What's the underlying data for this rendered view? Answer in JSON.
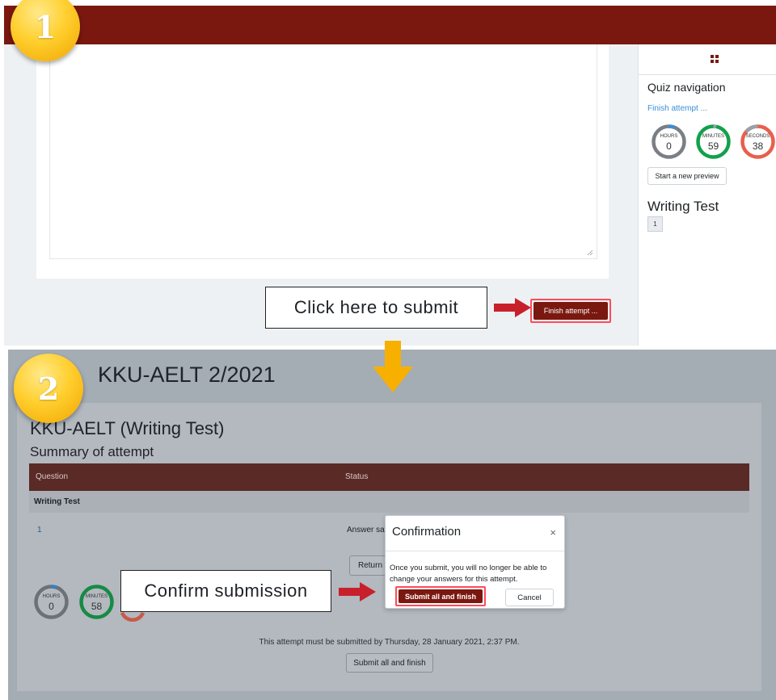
{
  "steps": {
    "step1": "1",
    "step2": "2"
  },
  "panel1": {
    "finish_button_label": "Finish attempt ...",
    "callout": "Click here to submit",
    "sidebar": {
      "quiz_navigation_title": "Quiz navigation",
      "finish_link": "Finish attempt ...",
      "timers": [
        {
          "label": "HOURS",
          "value": "0",
          "color": "#7a7f85"
        },
        {
          "label": "MINUTES",
          "value": "59",
          "color": "#12a14b"
        },
        {
          "label": "SECONDS",
          "value": "38",
          "color": "#e8604c"
        }
      ],
      "preview_button_label": "Start a new preview",
      "section_title": "Writing Test",
      "question_numbers": [
        "1"
      ]
    }
  },
  "panel2": {
    "course_title": "KKU-AELT 2/2021",
    "quiz_title": "KKU-AELT (Writing Test)",
    "summary_title": "Summary of attempt",
    "table": {
      "headers": [
        "Question",
        "Status"
      ],
      "section": "Writing Test",
      "rows": [
        {
          "question": "1",
          "status": "Answer sav"
        }
      ]
    },
    "return_button_label": "Return t",
    "timers": [
      {
        "label": "HOURS",
        "value": "0",
        "color": "#7a7f85"
      },
      {
        "label": "MINUTES",
        "value": "58",
        "color": "#12a14b"
      }
    ],
    "due_text": "This attempt must be submitted by Thursday, 28 January 2021, 2:37 PM.",
    "submit_button_label": "Submit all and finish",
    "callout": "Confirm submission",
    "dialog": {
      "title": "Confirmation",
      "close_symbol": "×",
      "body": "Once you submit, you will no longer be able to change your answers for this attempt.",
      "submit_label": "Submit all and finish",
      "cancel_label": "Cancel"
    }
  },
  "colors": {
    "header": "#7a1810",
    "highlight": "#ff4b5a",
    "badge": "#ffcf2e",
    "arrow_red": "#c8202b",
    "arrow_orange": "#f7b000"
  }
}
